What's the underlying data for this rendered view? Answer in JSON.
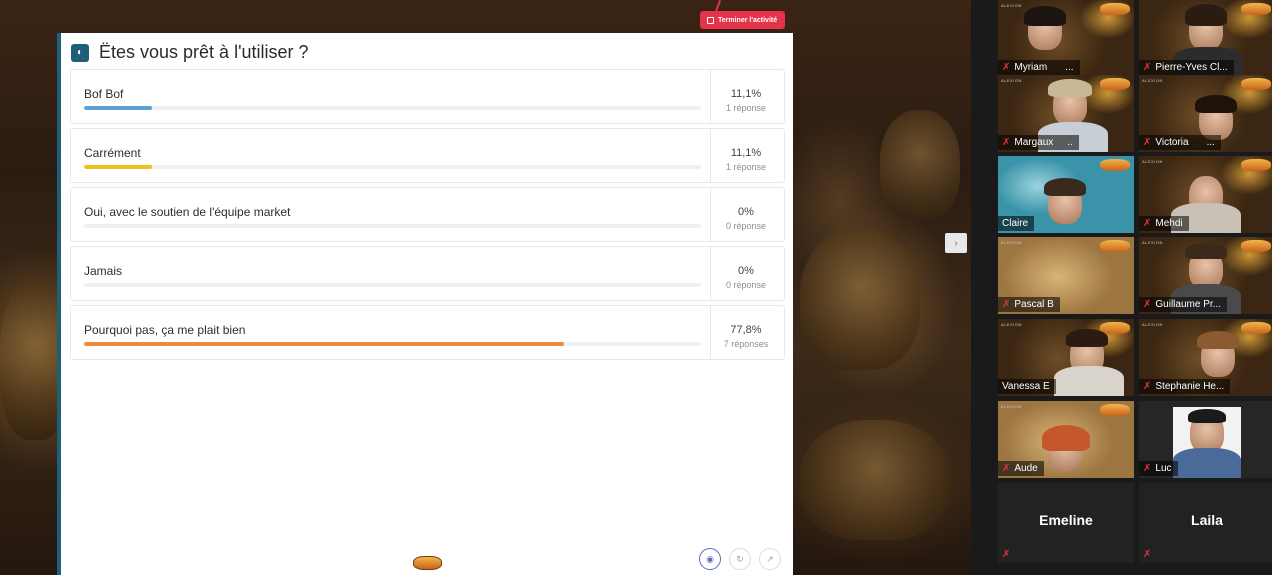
{
  "poll": {
    "title": "Ëtes vous prêt à l'utiliser ?",
    "end_activity_label": "Terminer l'activité",
    "options": [
      {
        "label": "Bof Bof",
        "percent": "11,1%",
        "responses": "1 réponse",
        "fill": 0.111,
        "color": "#5ba3d6"
      },
      {
        "label": "Carrément",
        "percent": "11,1%",
        "responses": "1 réponse",
        "fill": 0.111,
        "color": "#f1c118"
      },
      {
        "label": "Oui, avec le soutien de l'équipe market",
        "percent": "0%",
        "responses": "0 réponse",
        "fill": 0,
        "color": "#5ba3d6"
      },
      {
        "label": "Jamais",
        "percent": "0%",
        "responses": "0 réponse",
        "fill": 0,
        "color": "#5ba3d6"
      },
      {
        "label": "Pourquoi pas, ça me plait bien",
        "percent": "77,8%",
        "responses": "7 réponses",
        "fill": 0.778,
        "color": "#ef8a3a"
      }
    ]
  },
  "participants": [
    {
      "name": "Myriam",
      "suffix": "..."
    },
    {
      "name": "Pierre-Yves Cl...",
      "suffix": ""
    },
    {
      "name": "Margaux",
      "suffix": ".."
    },
    {
      "name": "Victoria",
      "suffix": "..."
    },
    {
      "name": "Claire",
      "suffix": ""
    },
    {
      "name": "Mehdi",
      "suffix": ""
    },
    {
      "name": "Pascal B",
      "suffix": ""
    },
    {
      "name": "Guillaume Pr...",
      "suffix": ""
    },
    {
      "name": "Vanessa E",
      "suffix": ""
    },
    {
      "name": "Stephanie He...",
      "suffix": ""
    },
    {
      "name": "Aude",
      "suffix": ""
    },
    {
      "name": "Luc",
      "suffix": ""
    },
    {
      "name": "Emeline",
      "suffix": ""
    },
    {
      "name": "Laila",
      "suffix": ""
    }
  ],
  "icons": {
    "muted_mic": "mic-muted-icon",
    "next": "chevron-right-icon",
    "poll": "poll-icon"
  }
}
